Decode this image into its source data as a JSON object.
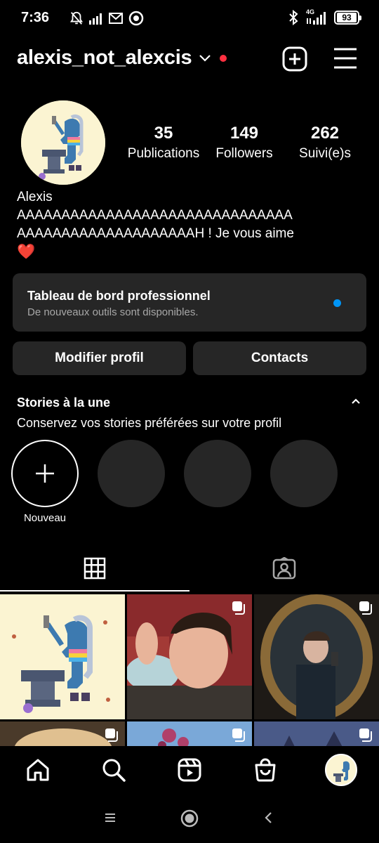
{
  "status_bar": {
    "time": "7:36",
    "network": "4G",
    "battery": "93",
    "left_icons": [
      "mute-bell-icon",
      "signal-bars-icon",
      "gmail-icon",
      "record-icon"
    ],
    "right_icons": [
      "bluetooth-icon",
      "cell-signal-icon",
      "battery-icon"
    ]
  },
  "header": {
    "username": "alexis_not_alexcis",
    "notification_color": "#ff3040"
  },
  "profile": {
    "stats": [
      {
        "value": "35",
        "label": "Publications"
      },
      {
        "value": "149",
        "label": "Followers"
      },
      {
        "value": "262",
        "label": "Suivi(e)s"
      }
    ],
    "name": "Alexis",
    "bio_line1": "AAAAAAAAAAAAAAAAAAAAAAAAAAAAAAA",
    "bio_line2": "AAAAAAAAAAAAAAAAAAAAH ! Je vous aime",
    "bio_heart": "❤️"
  },
  "dashboard": {
    "title": "Tableau de bord professionnel",
    "subtitle": "De nouveaux outils sont disponibles.",
    "dot_color": "#0095f6"
  },
  "actions": {
    "edit_profile": "Modifier profil",
    "contacts": "Contacts"
  },
  "stories": {
    "title": "Stories à la une",
    "subtitle": "Conservez vos stories préférées sur votre profil",
    "new_label": "Nouveau",
    "placeholder_count": 3
  },
  "tabs": [
    "grid-icon",
    "tagged-icon"
  ],
  "grid": [
    {
      "content": "cartoon-avatar-image",
      "multi": false
    },
    {
      "content": "portrait-photo",
      "multi": true
    },
    {
      "content": "mirror-selfie-photo",
      "multi": true
    },
    {
      "content": "portrait-photo",
      "multi": true
    },
    {
      "content": "blossom-sky-photo",
      "multi": true
    },
    {
      "content": "sky-photo",
      "multi": true
    }
  ],
  "bottom_nav": [
    "home-icon",
    "search-icon",
    "reels-icon",
    "shop-icon",
    "profile-avatar"
  ],
  "system_nav": [
    "menu-icon",
    "home-circle-icon",
    "back-icon"
  ]
}
